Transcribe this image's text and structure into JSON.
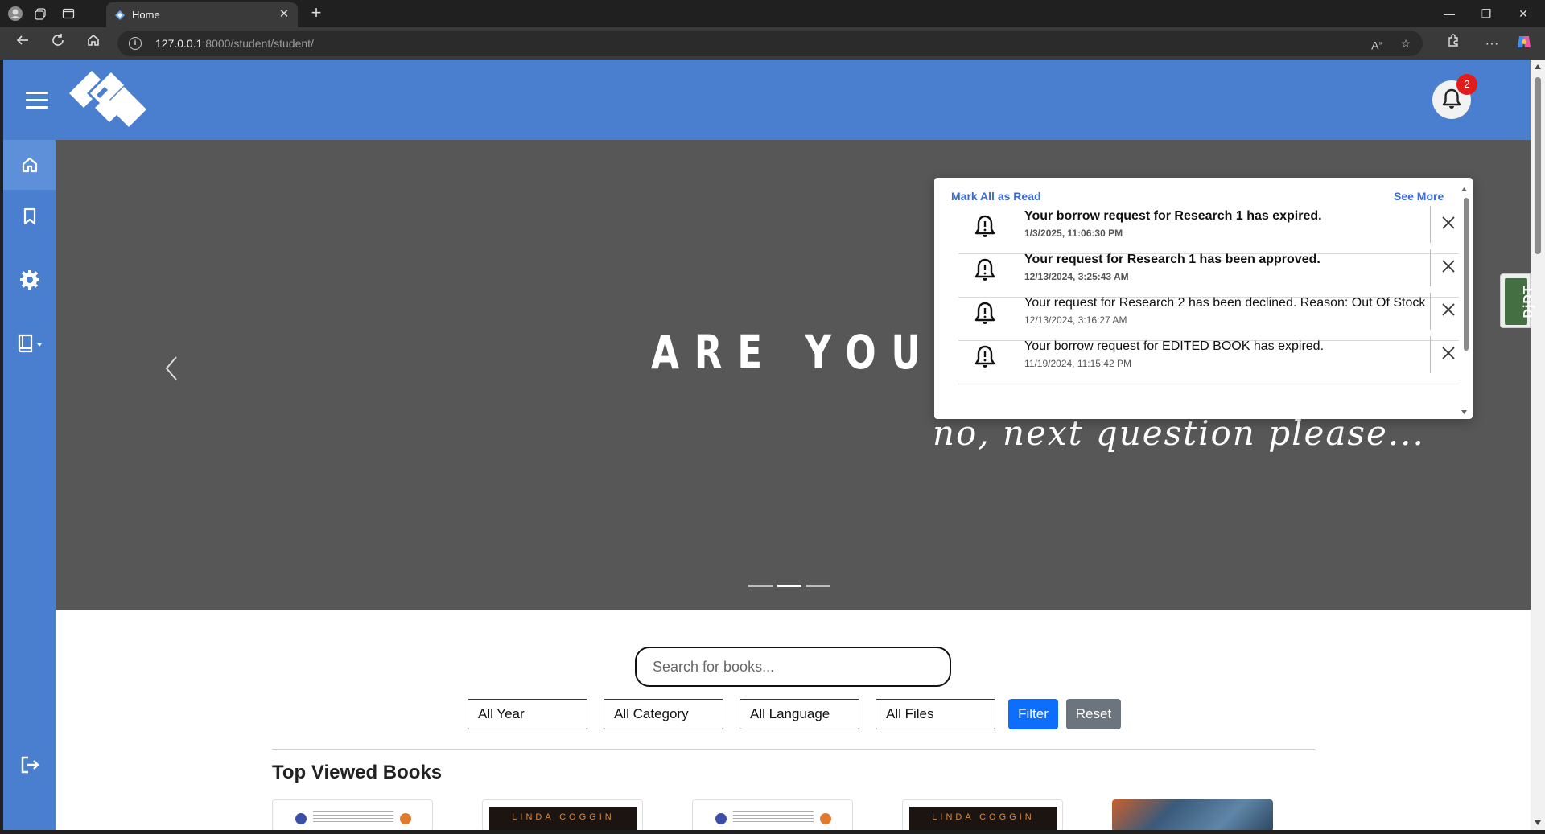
{
  "browser": {
    "tab_title": "Home",
    "address_host": "127.0.0.1",
    "address_rest": ":8000/student/student/"
  },
  "header": {
    "notification_count": "2"
  },
  "carousel": {
    "title": "ARE YOU OK?",
    "subtitle": "no, next question please...",
    "slide_count": 3,
    "active_slide": 2
  },
  "search": {
    "placeholder": "Search for books..."
  },
  "filters": {
    "year": "All Year",
    "category": "All Category",
    "language": "All Language",
    "files": "All Files",
    "filter_label": "Filter",
    "reset_label": "Reset"
  },
  "top_viewed": {
    "title": "Top Viewed Books",
    "books": [
      {
        "type": "document"
      },
      {
        "type": "novel",
        "author": "LINDA COGGIN"
      },
      {
        "type": "document"
      },
      {
        "type": "novel",
        "author": "LINDA COGGIN"
      },
      {
        "type": "image"
      }
    ]
  },
  "notifications": {
    "mark_all": "Mark All as Read",
    "see_more": "See More",
    "items": [
      {
        "message": "Your borrow request for Research 1 has expired.",
        "time": "1/3/2025, 11:06:30 PM",
        "unread": true
      },
      {
        "message": "Your request for Research 1 has been approved.",
        "time": "12/13/2024, 3:25:43 AM",
        "unread": true
      },
      {
        "message": "Your request for Research 2 has been declined. Reason: Out Of Stock",
        "time": "12/13/2024, 3:16:27 AM",
        "unread": false
      },
      {
        "message": "Your borrow request for EDITED BOOK has expired.",
        "time": "11/19/2024, 11:15:42 PM",
        "unread": false
      }
    ]
  },
  "djdt": {
    "label": "DjDT"
  },
  "colors": {
    "primary": "#4a7fd0",
    "sidebar_active": "#5e8fd9",
    "carousel_bg": "#575757",
    "link": "#3a6bd4",
    "badge": "#e21b1b",
    "filter_btn": "#0d6efd",
    "reset_btn": "#6c757d"
  },
  "icons": [
    "profile-icon",
    "workspaces-icon",
    "tab-actions-icon",
    "home-icon",
    "bookmark-icon",
    "settings-icon",
    "book-icon",
    "logout-icon",
    "bell-icon",
    "close-icon",
    "chevron-left-icon",
    "chevron-right-icon"
  ]
}
